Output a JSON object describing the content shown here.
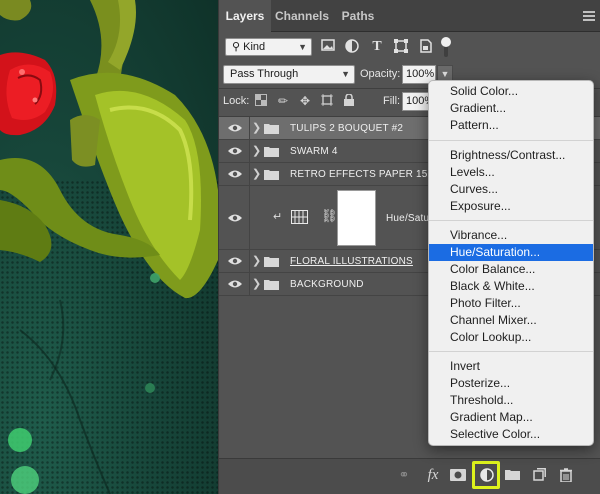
{
  "layers_panel": {
    "tabs": [
      {
        "label": "Layers"
      },
      {
        "label": "Channels"
      },
      {
        "label": "Paths"
      }
    ],
    "kind_filter": {
      "label": "Kind",
      "icons": [
        "image-filter-icon",
        "adjustment-filter-icon",
        "type-filter-icon",
        "shape-filter-icon",
        "smart-object-filter-icon"
      ]
    },
    "blend_mode": "Pass Through",
    "opacity": {
      "label": "Opacity:",
      "value": "100%"
    },
    "lock": {
      "label": "Lock:",
      "icons": [
        "lock-pixels-icon",
        "lock-paint-icon",
        "lock-position-icon",
        "lock-artboard-icon",
        "lock-all-icon"
      ]
    },
    "fill": {
      "label": "Fill:",
      "value": "100%"
    },
    "layers": [
      {
        "name": "TULIPS 2 BOUQUET #2",
        "type": "group",
        "visible": true
      },
      {
        "name": "SWARM 4",
        "type": "group",
        "visible": true
      },
      {
        "name": "RETRO EFFECTS PAPER 15",
        "type": "group",
        "visible": true
      },
      {
        "name": "Hue/Satu",
        "type": "adjustment",
        "visible": true
      },
      {
        "name": "FLORAL ILLUSTRATIONS",
        "type": "group",
        "visible": true
      },
      {
        "name": "BACKGROUND",
        "type": "group",
        "visible": true
      }
    ],
    "bottom_icons": [
      "link-layers-icon",
      "fx-icon",
      "add-mask-icon",
      "new-adjustment-layer-icon",
      "new-group-icon",
      "new-layer-icon",
      "trash-icon"
    ],
    "bottom_fx_label": "fx"
  },
  "adjustment_menu": {
    "groups": [
      [
        "Solid Color...",
        "Gradient...",
        "Pattern..."
      ],
      [
        "Brightness/Contrast...",
        "Levels...",
        "Curves...",
        "Exposure..."
      ],
      [
        "Vibrance...",
        "Hue/Saturation...",
        "Color Balance...",
        "Black & White...",
        "Photo Filter...",
        "Channel Mixer...",
        "Color Lookup..."
      ],
      [
        "Invert",
        "Posterize...",
        "Threshold...",
        "Gradient Map...",
        "Selective Color..."
      ]
    ],
    "highlighted": "Hue/Saturation..."
  },
  "colors": {
    "highlight": "#1b6ce3",
    "focus_ring": "#ddf21c",
    "panel": "#535353"
  }
}
